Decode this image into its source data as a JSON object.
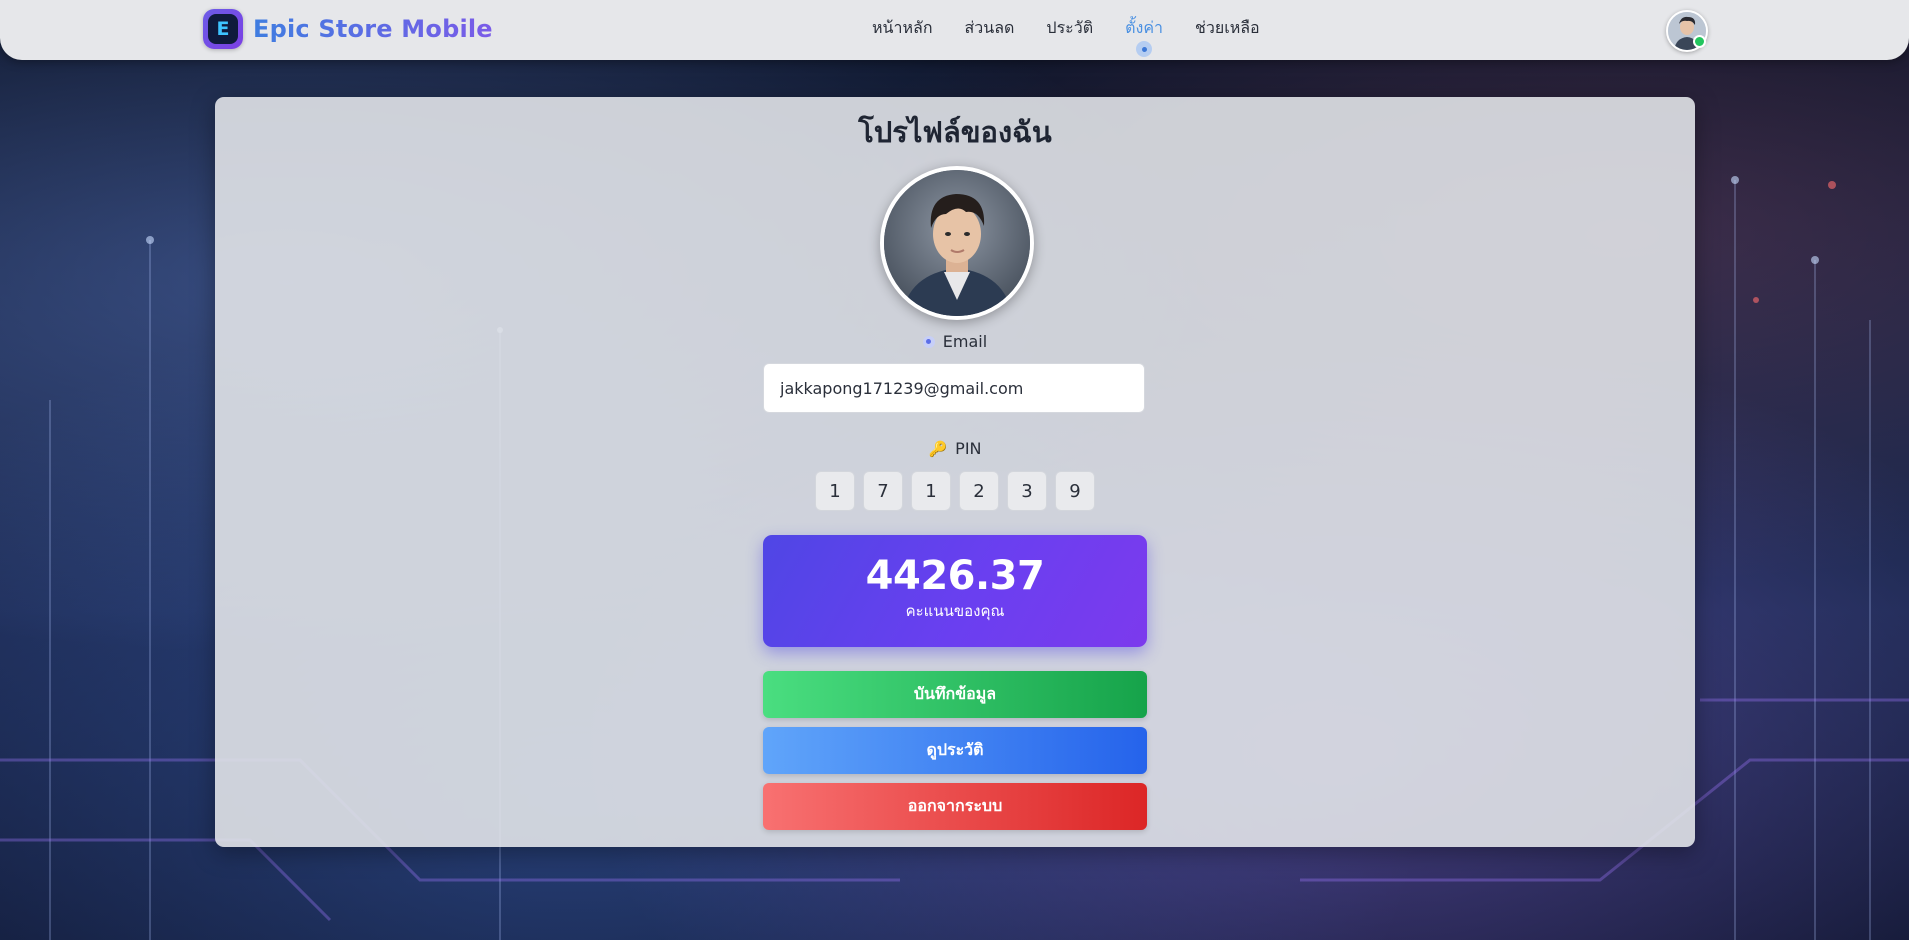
{
  "navbar": {
    "brand_title": "Epic Store Mobile",
    "logo_letter": "E",
    "links": [
      {
        "label": "หน้าหลัก"
      },
      {
        "label": "ส่วนลด"
      },
      {
        "label": "ประวัติ"
      },
      {
        "label": "ตั้งค่า"
      },
      {
        "label": "ช่วยเหลือ"
      }
    ],
    "active_index": 3
  },
  "profile": {
    "title": "โปรไฟล์ของฉัน",
    "email_label": "Email",
    "email_value": "jakkapong171239@gmail.com",
    "pin_label": "PIN",
    "pin_digits": [
      "1",
      "7",
      "1",
      "2",
      "3",
      "9"
    ],
    "points_value": "4426.37",
    "points_label": "คะแนนของคุณ"
  },
  "actions": {
    "save_label": "บันทึกข้อมูล",
    "history_label": "ดูประวัติ",
    "logout_label": "ออกจากระบบ"
  },
  "icons": {
    "email": "email-dot-icon",
    "pin": "key-icon",
    "logo": "store-logo-icon"
  },
  "colors": {
    "accent": "#4a90e2",
    "points_gradient_start": "#4f46e5",
    "points_gradient_end": "#7c3aed",
    "save": "#22c55e",
    "history": "#3b82f6",
    "logout": "#ef4444"
  }
}
